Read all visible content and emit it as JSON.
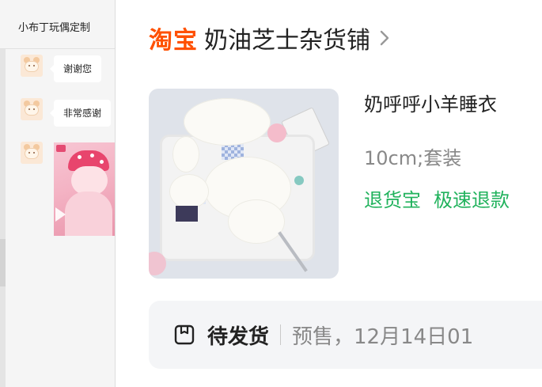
{
  "chat": {
    "title": "小布丁玩偶定制",
    "messages": [
      {
        "type": "text",
        "text": "谢谢您"
      },
      {
        "type": "text",
        "text": "非常感谢"
      },
      {
        "type": "video"
      }
    ]
  },
  "order": {
    "platform": "淘宝",
    "shop_name": "奶油芝士杂货铺",
    "product_title": "奶呼呼小羊睡衣",
    "product_spec": "10cm;套装",
    "tags": [
      "退货宝",
      "极速退款"
    ],
    "status_label": "待发货",
    "status_detail": "预售，12月14日01"
  },
  "colors": {
    "brand_orange": "#ff5000",
    "tag_green": "#20b25c"
  },
  "icons": [
    "shop-chevron-icon",
    "package-box-icon",
    "video-play-icon"
  ]
}
